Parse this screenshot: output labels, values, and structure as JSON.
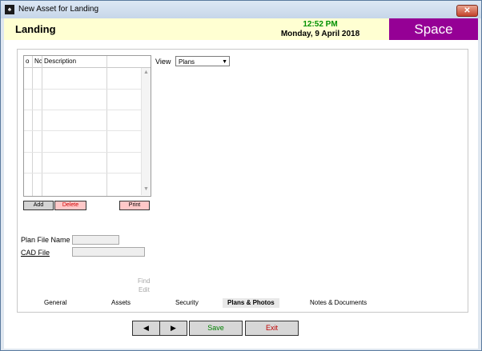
{
  "window": {
    "title": "New Asset for Landing",
    "close_label": "✕",
    "app_icon_glyph": "♠"
  },
  "header": {
    "title": "Landing",
    "time": "12:52 PM",
    "date": "Monday, 9 April 2018",
    "space_label": "Space"
  },
  "grid": {
    "columns": [
      "o",
      "Nc",
      "Description"
    ],
    "scroll_up": "▲",
    "scroll_down": "▼"
  },
  "buttons": {
    "add": "Add",
    "delete": "Delete",
    "print": "Print"
  },
  "view": {
    "label": "View",
    "selected": "Plans",
    "arrow": "▼"
  },
  "fields": {
    "plan_file_name_label": "Plan File Name",
    "plan_file_name_value": "",
    "cad_file_label": "CAD File",
    "cad_file_value": ""
  },
  "actions": {
    "find": "Find",
    "edit": "Edit"
  },
  "tabs": [
    "General",
    "Assets",
    "Security",
    "Plans & Photos",
    "Notes & Documents"
  ],
  "nav": {
    "prev": "◀",
    "next": "▶",
    "save": "Save",
    "exit": "Exit"
  },
  "colors": {
    "space_bg": "#950095",
    "header_bg": "#ffffd2",
    "time_color": "#009100",
    "delete_text": "#d00000",
    "print_bg": "#ffc8c8",
    "save_text": "#008000",
    "exit_text": "#c00000"
  }
}
